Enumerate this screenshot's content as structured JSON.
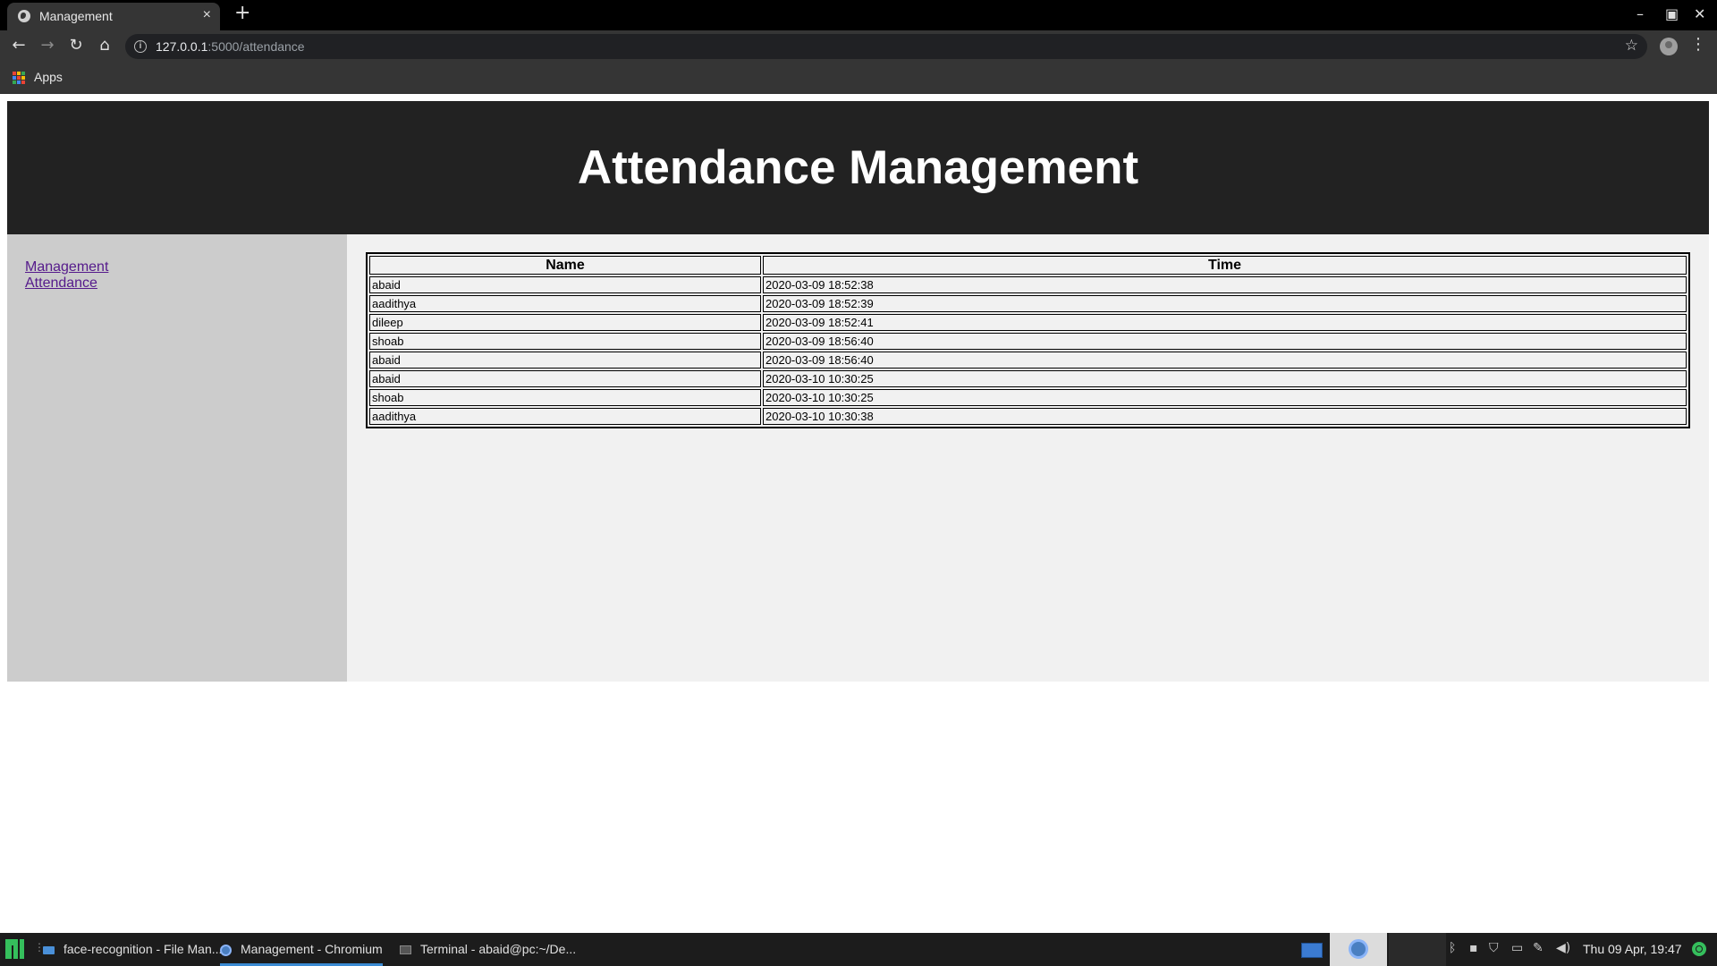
{
  "browser": {
    "tab_title": "Management",
    "tab_close": "×",
    "new_tab": "+",
    "url_host": "127.0.0.1",
    "url_rest": ":5000/attendance",
    "bookmarks_apps": "Apps",
    "window_controls": {
      "minimize": "–",
      "maximize": "▣",
      "close": "✕"
    }
  },
  "page": {
    "title": "Attendance Management",
    "sidebar_links": [
      "Management",
      "Attendance"
    ],
    "table": {
      "headers": [
        "Name",
        "Time"
      ],
      "rows": [
        [
          "abaid",
          "2020-03-09 18:52:38"
        ],
        [
          "aadithya",
          "2020-03-09 18:52:39"
        ],
        [
          "dileep",
          "2020-03-09 18:52:41"
        ],
        [
          "shoab",
          "2020-03-09 18:56:40"
        ],
        [
          "abaid",
          "2020-03-09 18:56:40"
        ],
        [
          "abaid",
          "2020-03-10 10:30:25"
        ],
        [
          "shoab",
          "2020-03-10 10:30:25"
        ],
        [
          "aadithya",
          "2020-03-10 10:30:38"
        ]
      ]
    }
  },
  "taskbar": {
    "tasks": [
      "face-recognition - File Man...",
      "Management - Chromium",
      "Terminal - abaid@pc:~/De..."
    ],
    "clock": "Thu 09 Apr, 19:47"
  },
  "icons": {
    "tab_favicon": "globe-icon",
    "back": "arrow-left-icon",
    "forward": "arrow-right-icon",
    "reload": "reload-icon",
    "home": "home-icon",
    "info": "info-icon",
    "bookmark": "star-icon",
    "apps": "apps-grid-icon"
  },
  "colors": {
    "header_bg": "#222222",
    "sidebar_bg": "#cccccc",
    "main_bg": "#f1f1f1",
    "link": "#551a8b",
    "taskbar_accent": "#3b8bd3",
    "manjaro_green": "#35bf5c"
  }
}
